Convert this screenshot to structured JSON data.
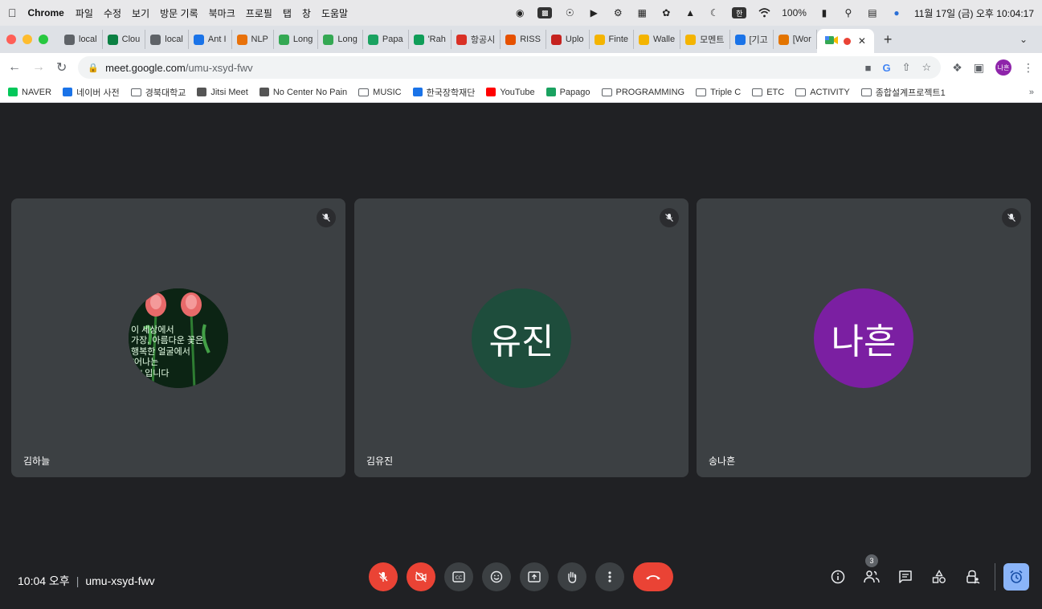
{
  "menubar": {
    "app": "Chrome",
    "items": [
      "파일",
      "수정",
      "보기",
      "방문 기록",
      "북마크",
      "프로필",
      "탭",
      "창",
      "도움말"
    ],
    "input_source": "한",
    "battery": "100%",
    "clock": "11월 17일 (금) 오후 10:04:17"
  },
  "tabs": [
    {
      "label": "local",
      "color": "#5f6368"
    },
    {
      "label": "Clou",
      "color": "#0b8043"
    },
    {
      "label": "local",
      "color": "#5f6368"
    },
    {
      "label": "Ant I",
      "color": "#1a73e8"
    },
    {
      "label": "NLP",
      "color": "#e8710a"
    },
    {
      "label": "Long",
      "color": "#34a853"
    },
    {
      "label": "Long",
      "color": "#34a853"
    },
    {
      "label": "Papa",
      "color": "#1aa260"
    },
    {
      "label": "'Rah",
      "color": "#0f9d58"
    },
    {
      "label": "항공시",
      "color": "#d93025"
    },
    {
      "label": "RISS",
      "color": "#e65100"
    },
    {
      "label": "Uplo",
      "color": "#c5221f"
    },
    {
      "label": "Finte",
      "color": "#f4b400"
    },
    {
      "label": "Walle",
      "color": "#f4b400"
    },
    {
      "label": "모멘트",
      "color": "#f4b400"
    },
    {
      "label": "[기고",
      "color": "#1a73e8"
    },
    {
      "label": "[Wor",
      "color": "#e37400"
    }
  ],
  "address": {
    "host": "meet.google.com",
    "path": "/umu-xsyd-fwv"
  },
  "profile_initial": "나흔",
  "bookmarks": [
    {
      "label": "NAVER",
      "type": "site",
      "color": "#03c75a"
    },
    {
      "label": "네이버 사전",
      "type": "site",
      "color": "#1a73e8"
    },
    {
      "label": "경북대학교",
      "type": "folder"
    },
    {
      "label": "Jitsi Meet",
      "type": "site",
      "color": "#555555"
    },
    {
      "label": "No Center No Pain",
      "type": "site",
      "color": "#555555"
    },
    {
      "label": "MUSIC",
      "type": "folder"
    },
    {
      "label": "한국장학재단",
      "type": "site",
      "color": "#1a73e8"
    },
    {
      "label": "YouTube",
      "type": "site",
      "color": "#ff0000"
    },
    {
      "label": "Papago",
      "type": "site",
      "color": "#1aa260"
    },
    {
      "label": "PROGRAMMING",
      "type": "folder"
    },
    {
      "label": "Triple C",
      "type": "folder"
    },
    {
      "label": "ETC",
      "type": "folder"
    },
    {
      "label": "ACTIVITY",
      "type": "folder"
    },
    {
      "label": "종합설계프로젝트1",
      "type": "folder"
    }
  ],
  "participants": [
    {
      "name": "김하늘",
      "avatar_type": "photo",
      "photo_text": [
        "이  세상에서",
        "가장,  아름다운  꽃은",
        "행복한  얼굴에서",
        "\"어나는",
        "꽃\" 입니다"
      ]
    },
    {
      "name": "김유진",
      "avatar_type": "initials",
      "initials": "유진",
      "color": "#1e4d3c"
    },
    {
      "name": "송나흔",
      "avatar_type": "initials",
      "initials": "나흔",
      "color": "#7b1fa2"
    }
  ],
  "meeting": {
    "time": "10:04 오후",
    "code": "umu-xsyd-fwv",
    "participant_count": "3"
  },
  "colors": {
    "stage_bg": "#202124",
    "tile_bg": "#3c4043",
    "danger": "#ea4335",
    "accent": "#8ab4f8"
  }
}
